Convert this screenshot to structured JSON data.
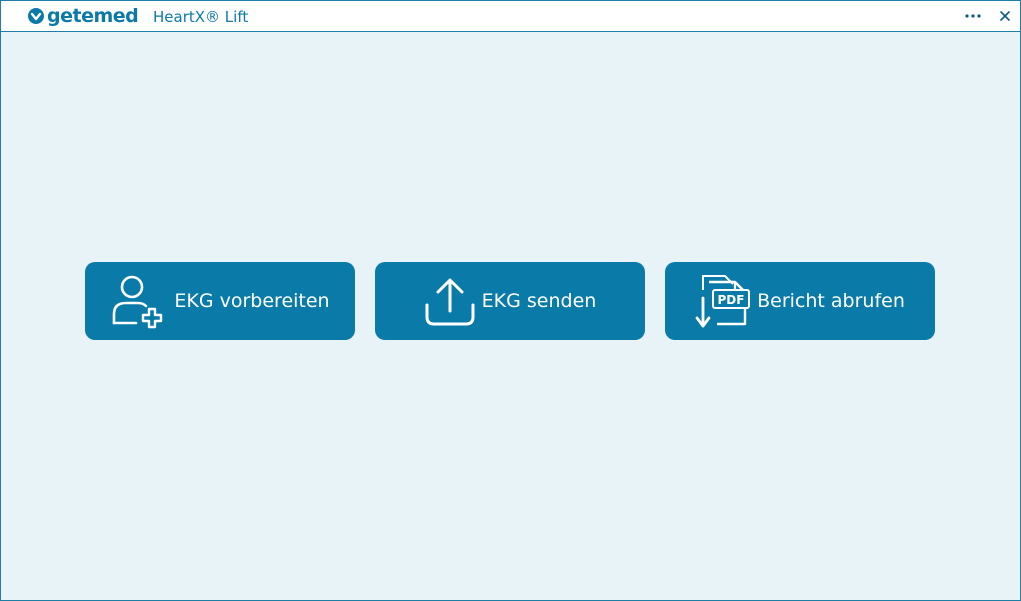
{
  "titlebar": {
    "brand": "getemed",
    "app_title": "HeartX® Lift",
    "more_icon": "more-horizontal-icon",
    "close_icon": "close-icon"
  },
  "actions": [
    {
      "label": "EKG vorbereiten",
      "icon": "user-add-icon"
    },
    {
      "label": "EKG senden",
      "icon": "upload-icon"
    },
    {
      "label": "Bericht abrufen",
      "icon": "pdf-download-icon"
    }
  ],
  "colors": {
    "accent": "#0a7ba8",
    "background": "#e8f3f8",
    "titlebar": "#ffffff",
    "border": "#1f7ea3"
  }
}
